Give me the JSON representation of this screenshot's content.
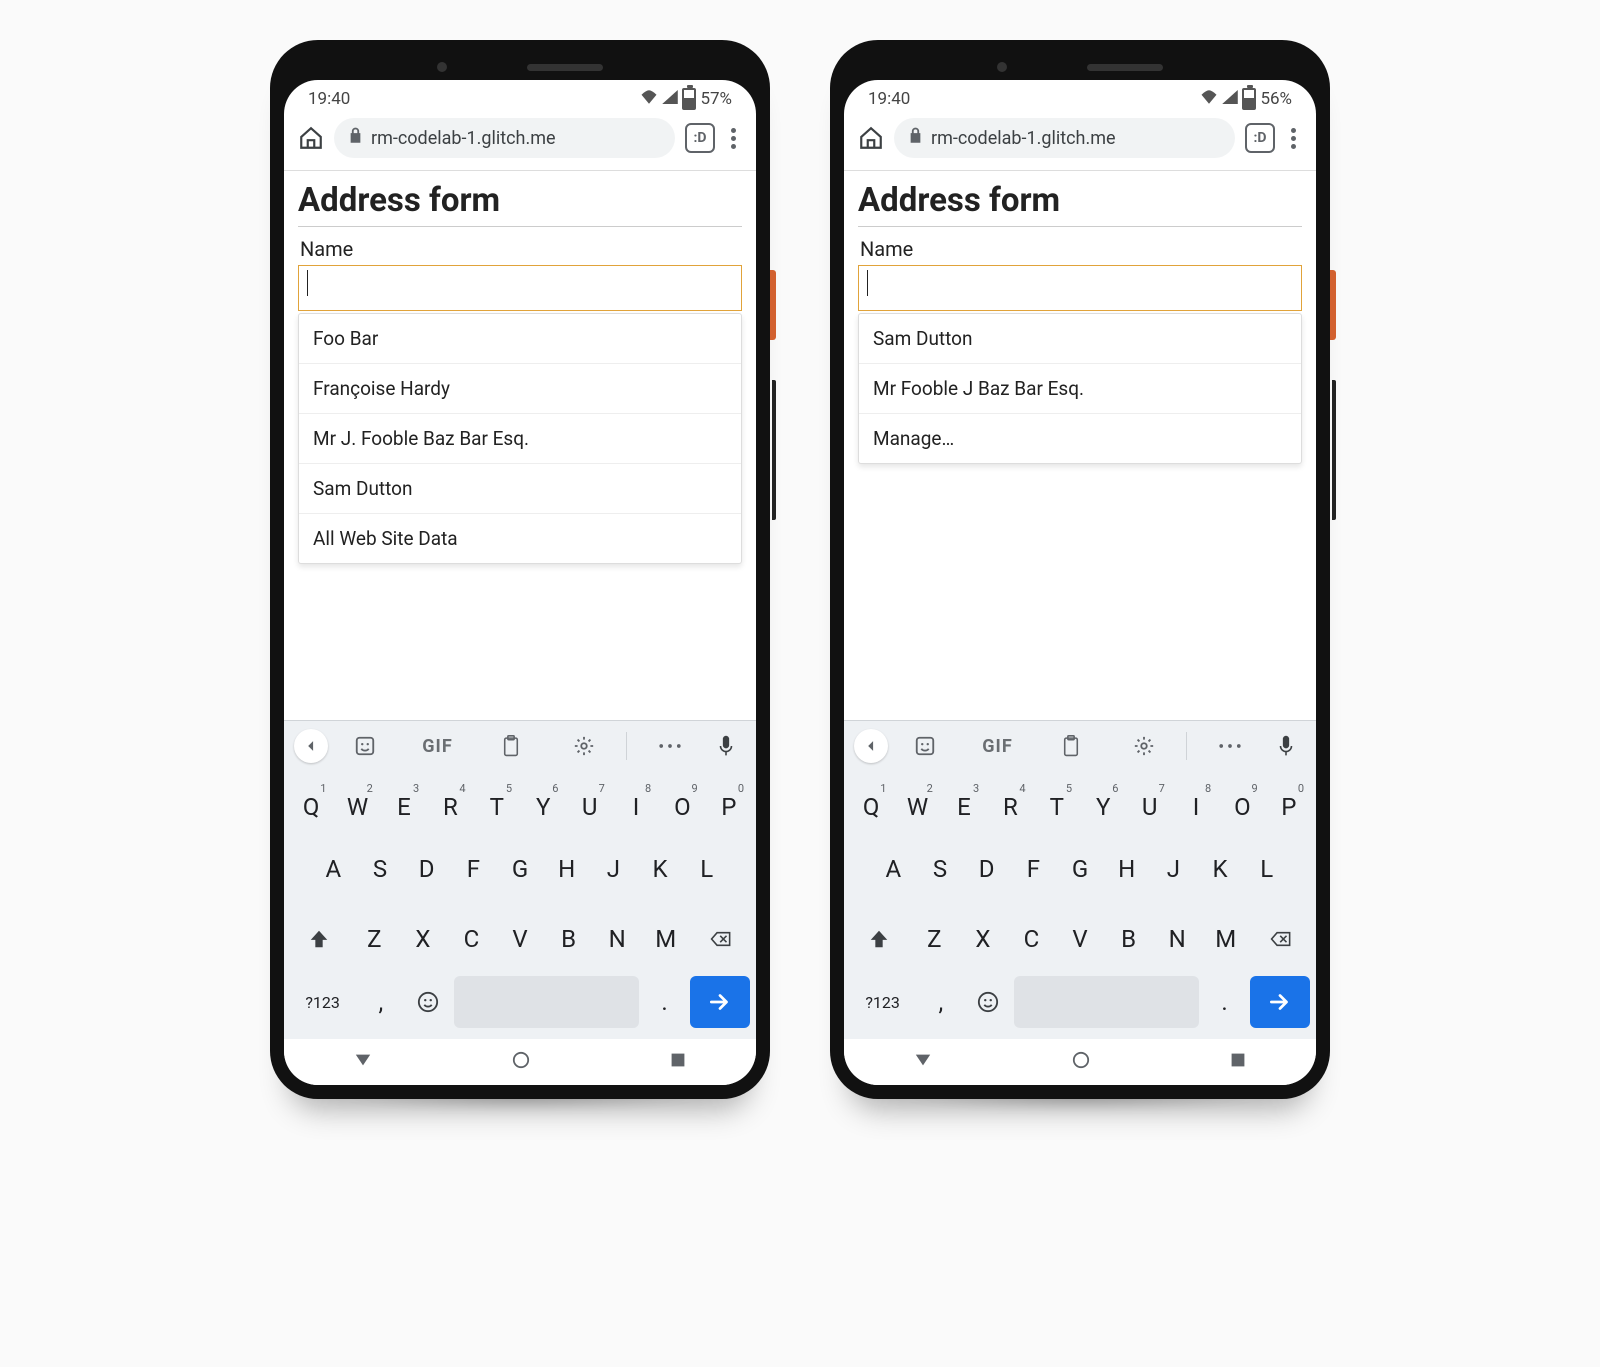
{
  "phones": [
    {
      "status": {
        "time": "19:40",
        "battery_text": "57%",
        "battery_pct": 57
      },
      "browser": {
        "url": "rm-codelab-1.glitch.me",
        "tab_badge": ":D"
      },
      "page": {
        "title": "Address form",
        "field_label": "Name",
        "input_value": "",
        "suggestions": [
          "Foo Bar",
          "Françoise Hardy",
          "Mr J. Fooble Baz Bar Esq.",
          "Sam Dutton",
          "All Web Site Data"
        ]
      }
    },
    {
      "status": {
        "time": "19:40",
        "battery_text": "56%",
        "battery_pct": 56
      },
      "browser": {
        "url": "rm-codelab-1.glitch.me",
        "tab_badge": ":D"
      },
      "page": {
        "title": "Address form",
        "field_label": "Name",
        "input_value": "",
        "suggestions": [
          "Sam Dutton",
          "Mr Fooble J Baz Bar Esq.",
          "Manage…"
        ]
      }
    }
  ],
  "keyboard": {
    "gif_label": "GIF",
    "row1": [
      {
        "k": "Q",
        "n": "1"
      },
      {
        "k": "W",
        "n": "2"
      },
      {
        "k": "E",
        "n": "3"
      },
      {
        "k": "R",
        "n": "4"
      },
      {
        "k": "T",
        "n": "5"
      },
      {
        "k": "Y",
        "n": "6"
      },
      {
        "k": "U",
        "n": "7"
      },
      {
        "k": "I",
        "n": "8"
      },
      {
        "k": "O",
        "n": "9"
      },
      {
        "k": "P",
        "n": "0"
      }
    ],
    "row2": [
      "A",
      "S",
      "D",
      "F",
      "G",
      "H",
      "J",
      "K",
      "L"
    ],
    "row3": [
      "Z",
      "X",
      "C",
      "V",
      "B",
      "N",
      "M"
    ],
    "sym_key": "?123",
    "comma": ",",
    "period": "."
  }
}
